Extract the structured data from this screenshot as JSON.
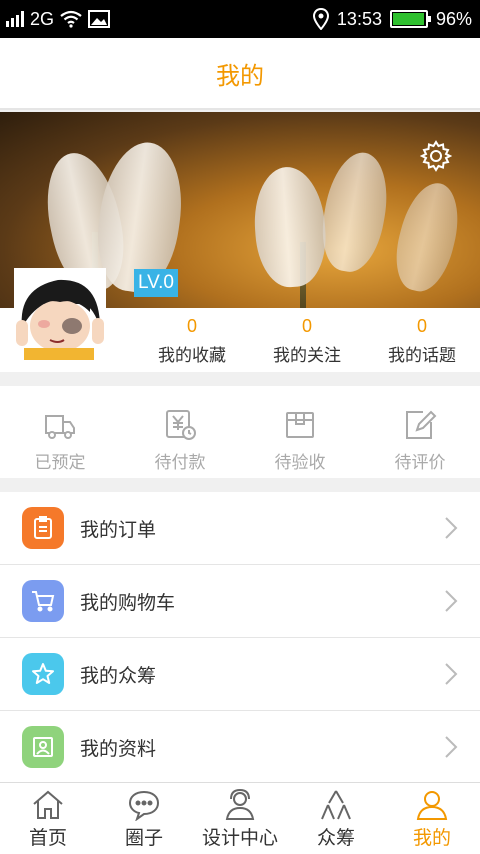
{
  "status_bar": {
    "network": "2G",
    "time": "13:53",
    "battery": "96%",
    "battery_level": 0.96
  },
  "header": {
    "title": "我的"
  },
  "profile": {
    "level": "LV.0",
    "stats": [
      {
        "count": "0",
        "label": "我的收藏"
      },
      {
        "count": "0",
        "label": "我的关注"
      },
      {
        "count": "0",
        "label": "我的话题"
      }
    ]
  },
  "orders": [
    {
      "label": "已预定",
      "icon": "truck-icon"
    },
    {
      "label": "待付款",
      "icon": "yen-clock-icon"
    },
    {
      "label": "待验收",
      "icon": "package-icon"
    },
    {
      "label": "待评价",
      "icon": "edit-icon"
    }
  ],
  "menu": [
    {
      "label": "我的订单",
      "icon": "order-list-icon",
      "color": "#f5792a"
    },
    {
      "label": "我的购物车",
      "icon": "cart-icon",
      "color": "#7b9cf0"
    },
    {
      "label": "我的众筹",
      "icon": "star-icon",
      "color": "#4bc8ec"
    },
    {
      "label": "我的资料",
      "icon": "profile-card-icon",
      "color": "#8fd37c"
    }
  ],
  "tabs": [
    {
      "label": "首页",
      "icon": "home-icon"
    },
    {
      "label": "圈子",
      "icon": "chat-icon"
    },
    {
      "label": "设计中心",
      "icon": "designer-icon"
    },
    {
      "label": "众筹",
      "icon": "crowd-icon"
    },
    {
      "label": "我的",
      "icon": "person-icon",
      "active": true
    }
  ],
  "colors": {
    "accent": "#f39800",
    "level_badge": "#39b3e6"
  }
}
